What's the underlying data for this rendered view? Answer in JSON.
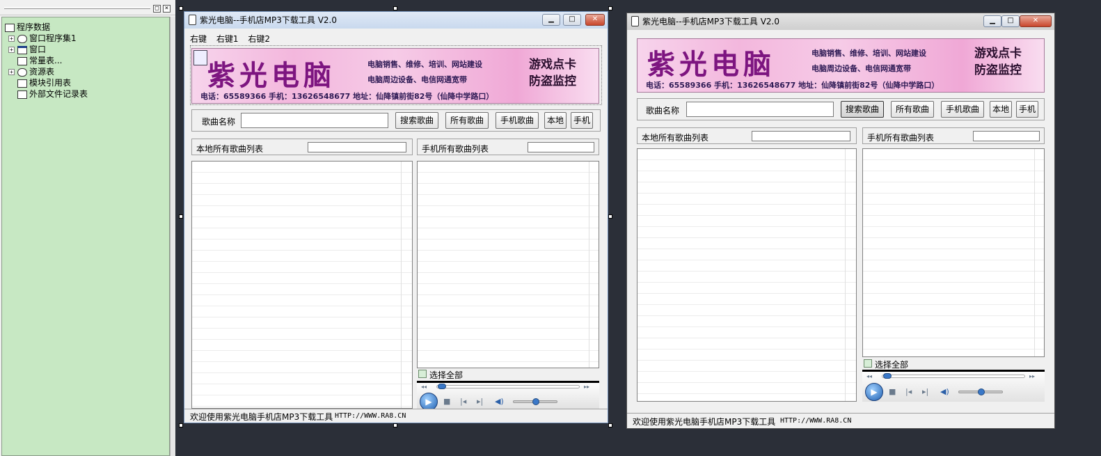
{
  "tree": {
    "root_label": "程序数据",
    "items": [
      {
        "label": "窗口程序集1",
        "expandable": true
      },
      {
        "label": "窗口",
        "expandable": true
      },
      {
        "label": "常量表...",
        "expandable": false
      },
      {
        "label": "资源表",
        "expandable": true
      },
      {
        "label": "模块引用表",
        "expandable": false
      },
      {
        "label": "外部文件记录表",
        "expandable": false
      }
    ],
    "pin_glyph": "□",
    "close_glyph": "×"
  },
  "window": {
    "title": "紫光电脑--手机店MP3下载工具 V2.0",
    "min_glyph": "▁",
    "max_glyph": "□",
    "close_glyph": "✕"
  },
  "menu": [
    "右键",
    "右键1",
    "右键2"
  ],
  "banner": {
    "name": "紫光电脑",
    "line1": "电脑销售、维修、培训、网站建设",
    "line2": "电脑周边设备、电信网通宽带",
    "big1": "游戏点卡",
    "big2": "防盗监控",
    "contact": "电话：65589366 手机：13626548677 地址：仙降镇前街82号（仙降中学路口）"
  },
  "search": {
    "label": "歌曲名称",
    "value": "",
    "buttons": {
      "search": "搜索歌曲",
      "all": "所有歌曲",
      "phone": "手机歌曲",
      "local": "本地",
      "mobile": "手机"
    }
  },
  "lists": {
    "local_title": "本地所有歌曲列表",
    "phone_title": "手机所有歌曲列表"
  },
  "select_all": "选择全部",
  "player_icons": {
    "rewind": "◂◂",
    "forward": "▸▸",
    "play": "▶",
    "stop": "■",
    "prev": "|◂",
    "next": "▸|",
    "volume": "◀)"
  },
  "status": {
    "welcome": "欢迎使用紫光电脑手机店MP3下载工具",
    "url": "HTTP://WWW.RA8.CN"
  }
}
